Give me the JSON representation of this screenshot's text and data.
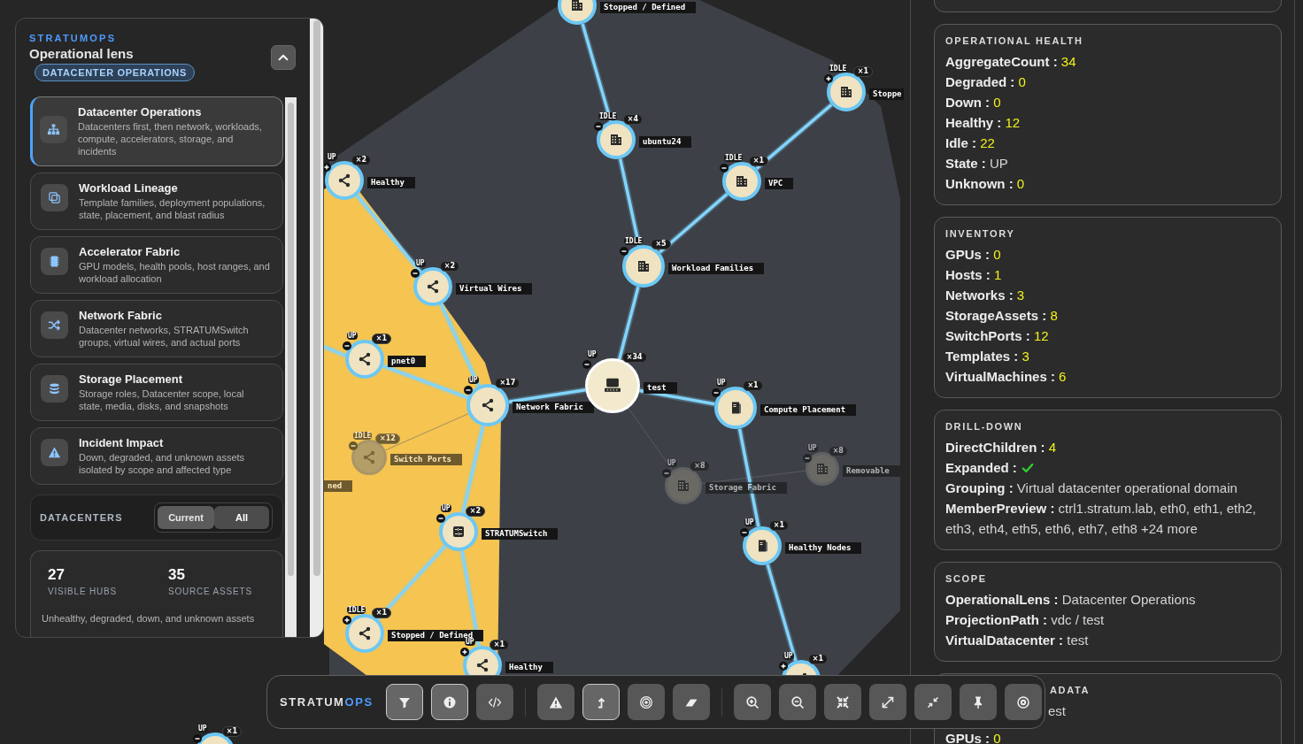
{
  "left_panel": {
    "brand": "STRATUMOPS",
    "title": "Operational lens",
    "badge": "DATACENTER OPERATIONS",
    "lenses": [
      {
        "title": "Datacenter Operations",
        "description": "Datacenters first, then network, workloads, compute, accelerators, storage, and incidents",
        "selected": true
      },
      {
        "title": "Workload Lineage",
        "description": "Template families, deployment populations, state, placement, and blast radius",
        "selected": false
      },
      {
        "title": "Accelerator Fabric",
        "description": "GPU models, health pools, host ranges, and workload allocation",
        "selected": false
      },
      {
        "title": "Network Fabric",
        "description": "Datacenter networks, STRATUMSwitch groups, virtual wires, and actual ports",
        "selected": false
      },
      {
        "title": "Storage Placement",
        "description": "Storage roles, Datacenter scope, local state, media, disks, and snapshots",
        "selected": false
      },
      {
        "title": "Incident Impact",
        "description": "Down, degraded, and unknown assets isolated by scope and affected type",
        "selected": false
      }
    ],
    "datacenters": {
      "label": "DATACENTERS",
      "options": [
        {
          "label": "Current",
          "selected": true
        },
        {
          "label": "All",
          "selected": false
        }
      ]
    },
    "stats": [
      {
        "value": "27",
        "label": "VISIBLE HUBS"
      },
      {
        "value": "35",
        "label": "SOURCE ASSETS"
      }
    ],
    "stats_note": "Unhealthy, degraded, down, and unknown assets"
  },
  "graph": {
    "nodes": [
      {
        "label": "Stopped / Defined",
        "selected": false,
        "dimmed": false
      },
      {
        "label": "Stoppe",
        "status": "IDLE",
        "count": "×1",
        "expanded": false,
        "selected": false,
        "dimmed": false
      },
      {
        "label": "ubuntu24",
        "status": "IDLE",
        "count": "×4",
        "expanded": true,
        "selected": false,
        "dimmed": false
      },
      {
        "label": "Healthy",
        "status": "UP",
        "count": "×2",
        "expanded": false,
        "selected": false,
        "dimmed": false
      },
      {
        "label": "VPC",
        "status": "IDLE",
        "count": "×1",
        "expanded": true,
        "selected": false,
        "dimmed": false
      },
      {
        "label": "Workload Families",
        "status": "IDLE",
        "count": "×5",
        "expanded": true,
        "selected": false,
        "dimmed": false
      },
      {
        "label": "Virtual Wires",
        "status": "UP",
        "count": "×2",
        "expanded": true,
        "selected": false,
        "dimmed": false
      },
      {
        "label": "pnet0",
        "status": "UP",
        "count": "×1",
        "expanded": true,
        "selected": false,
        "dimmed": false
      },
      {
        "label": "Network Fabric",
        "status": "UP",
        "count": "×17",
        "expanded": true,
        "selected": false,
        "dimmed": false
      },
      {
        "label": "test",
        "status": "UP",
        "count": "×34",
        "expanded": true,
        "selected": true,
        "dimmed": false
      },
      {
        "label": "Compute Placement",
        "status": "UP",
        "count": "×1",
        "expanded": true,
        "selected": false,
        "dimmed": false
      },
      {
        "label": "ned",
        "selected": false,
        "dimmed": true
      },
      {
        "label": "Switch Ports",
        "status": "IDLE",
        "count": "×12",
        "expanded": true,
        "selected": false,
        "dimmed": true
      },
      {
        "label": "Storage Fabric",
        "status": "UP",
        "count": "×8",
        "expanded": true,
        "selected": false,
        "dimmed": true
      },
      {
        "label": "Removable",
        "status": "UP",
        "count": "×8",
        "expanded": true,
        "selected": false,
        "dimmed": true
      },
      {
        "label": "STRATUMSwitch",
        "status": "UP",
        "count": "×2",
        "expanded": true,
        "selected": false,
        "dimmed": false
      },
      {
        "label": "Healthy Nodes",
        "status": "UP",
        "count": "×1",
        "expanded": true,
        "selected": false,
        "dimmed": false
      },
      {
        "label": "Stopped / Defined",
        "status": "IDLE",
        "count": "×1",
        "expanded": false,
        "selected": false,
        "dimmed": false
      },
      {
        "label": "Healthy",
        "status": "UP",
        "count": "×1",
        "expanded": false,
        "selected": false,
        "dimmed": false
      },
      {
        "status": "UP",
        "count": "×1",
        "expanded": false,
        "selected": false,
        "dimmed": false
      },
      {
        "status": "UP",
        "count": "×1",
        "expanded": true,
        "selected": false,
        "dimmed": false
      }
    ]
  },
  "details": {
    "cards": [
      {
        "title": "OPERATIONAL HEALTH",
        "rows": [
          {
            "key": "AggregateCount :",
            "value": "34",
            "kind": "number"
          },
          {
            "key": "Degraded :",
            "value": "0",
            "kind": "number"
          },
          {
            "key": "Down :",
            "value": "0",
            "kind": "number"
          },
          {
            "key": "Healthy :",
            "value": "12",
            "kind": "number"
          },
          {
            "key": "Idle :",
            "value": "22",
            "kind": "number"
          },
          {
            "key": "State :",
            "value": "UP",
            "kind": "text"
          },
          {
            "key": "Unknown :",
            "value": "0",
            "kind": "number"
          }
        ]
      },
      {
        "title": "INVENTORY",
        "rows": [
          {
            "key": "GPUs :",
            "value": "0",
            "kind": "number"
          },
          {
            "key": "Hosts :",
            "value": "1",
            "kind": "number"
          },
          {
            "key": "Networks :",
            "value": "3",
            "kind": "number"
          },
          {
            "key": "StorageAssets :",
            "value": "8",
            "kind": "number"
          },
          {
            "key": "SwitchPorts :",
            "value": "12",
            "kind": "number"
          },
          {
            "key": "Templates :",
            "value": "3",
            "kind": "number"
          },
          {
            "key": "VirtualMachines :",
            "value": "6",
            "kind": "number"
          }
        ]
      },
      {
        "title": "DRILL-DOWN",
        "rows": [
          {
            "key": "DirectChildren :",
            "value": "4",
            "kind": "number"
          },
          {
            "key": "Expanded :",
            "checked": true,
            "kind": "flag"
          },
          {
            "key": "Grouping :",
            "value": "Virtual datacenter operational domain",
            "kind": "text"
          },
          {
            "key": "MemberPreview :",
            "value": "ctrl1.stratum.lab, eth0, eth1, eth2, eth3, eth4, eth5, eth6, eth7, eth8 +24 more",
            "kind": "text"
          }
        ]
      },
      {
        "title": "SCOPE",
        "rows": [
          {
            "key": "OperationalLens :",
            "value": "Datacenter Operations",
            "kind": "text"
          },
          {
            "key": "ProjectionPath :",
            "value": "vdc / test",
            "kind": "text"
          },
          {
            "key": "VirtualDatacenter :",
            "value": "test",
            "kind": "text"
          }
        ]
      },
      {
        "title": "ADATA",
        "covered": true,
        "rows": [
          {
            "value": "est",
            "kind": "text",
            "covered": true
          },
          {
            "key": "GPUs :",
            "value": "0",
            "kind": "number"
          }
        ]
      }
    ]
  },
  "toolbar": {
    "brand": "STRATUM",
    "brand_accent": "OPS",
    "groups": [
      [
        {
          "on": true
        },
        {
          "on": true
        },
        {
          "on": false
        }
      ],
      [
        {
          "on": false
        },
        {
          "on": true
        },
        {
          "on": false
        },
        {
          "on": false
        }
      ],
      [
        {
          "on": false
        },
        {
          "on": false
        },
        {
          "on": false
        },
        {
          "on": false
        },
        {
          "on": false
        },
        {
          "on": false
        },
        {
          "on": false
        }
      ]
    ]
  }
}
